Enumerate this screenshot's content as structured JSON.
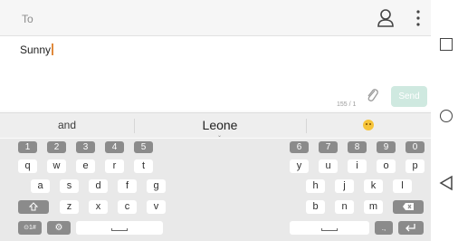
{
  "header": {
    "to_label": "To"
  },
  "compose": {
    "text": "Sunny",
    "counter": "155 / 1",
    "send_label": "Send"
  },
  "suggestions": {
    "first": "and",
    "second": "Leone",
    "third_icon": "emoji-icon"
  },
  "keyboard": {
    "numbers_left": [
      "1",
      "2",
      "3",
      "4",
      "5"
    ],
    "numbers_right": [
      "6",
      "7",
      "8",
      "9",
      "0"
    ],
    "row1_left": [
      "q",
      "w",
      "e",
      "r",
      "t"
    ],
    "row1_right": [
      "y",
      "u",
      "i",
      "o",
      "p"
    ],
    "row2_left": [
      "a",
      "s",
      "d",
      "f",
      "g"
    ],
    "row2_right": [
      "h",
      "j",
      "k",
      "l"
    ],
    "row3_left": [
      "z",
      "x",
      "c",
      "v"
    ],
    "row3_right": [
      "b",
      "n",
      "m"
    ],
    "sym_label": "⊙1#",
    "shift_icon": "shift-icon",
    "delete_icon": "delete-icon",
    "settings_icon": "gear-icon",
    "enter_icon": "enter-icon",
    "colors": {
      "num_key": "#8b8b8b",
      "letter_key": "#ffffff",
      "keyboard_bg": "#e9e9e9"
    }
  },
  "nav": {
    "recent_icon": "square-icon",
    "home_icon": "circle-icon",
    "back_icon": "back-triangle-icon"
  },
  "colors": {
    "send_disabled": "#cfe9e0",
    "caret": "#e08a3c"
  }
}
